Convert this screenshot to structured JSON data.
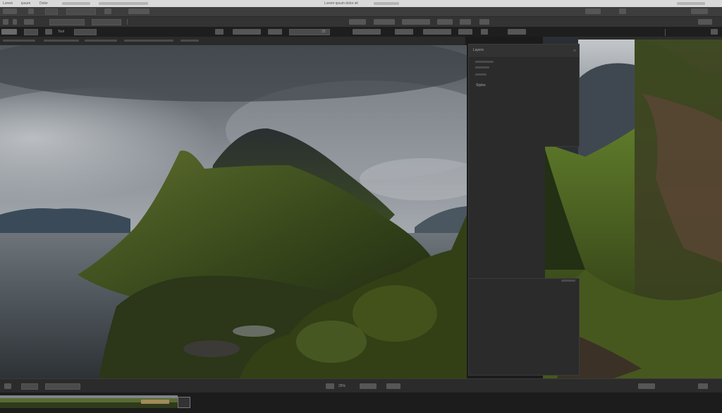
{
  "menubar": {
    "items": [
      "Lorem",
      "ipsum",
      "Dolor"
    ],
    "center_text": "Lorem ipsum dolor sit"
  },
  "toolbar3": {
    "tool_label": "Tool",
    "zoom_value": "25"
  },
  "panel": {
    "header_label": "Layers",
    "section_label": "Styles"
  },
  "status": {
    "zoom": "25%"
  },
  "colors": {
    "menubar_bg": "#d9d9d9",
    "toolbar_bg": "#3d3d3d",
    "panel_bg": "#2b2b2b",
    "canvas_bg": "#1b1b1b"
  }
}
